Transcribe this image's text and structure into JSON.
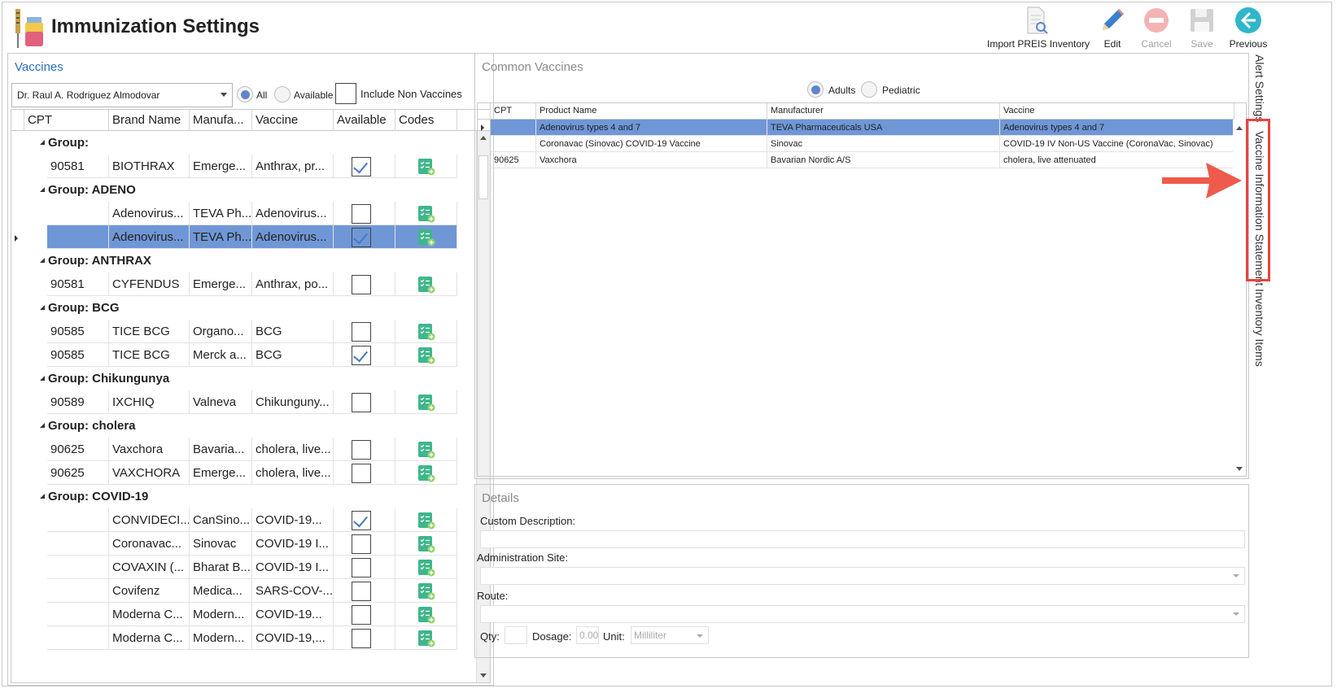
{
  "header": {
    "title": "Immunization Settings",
    "toolbar": {
      "import_label": "Import PREIS Inventory",
      "edit_label": "Edit",
      "cancel_label": "Cancel",
      "save_label": "Save",
      "previous_label": "Previous"
    }
  },
  "vaccines_panel": {
    "title": "Vaccines",
    "provider": "Dr. Raul A. Rodriguez Almodovar",
    "filter_all": "All",
    "filter_available": "Available",
    "filter_selected": "All",
    "include_non_vaccines_label": "Include Non Vaccines",
    "include_non_vaccines_checked": false,
    "columns": [
      "CPT",
      "Brand Name",
      "Manufa...",
      "Vaccine",
      "Available",
      "Codes"
    ],
    "rows": [
      {
        "type": "group",
        "label": "Group:"
      },
      {
        "type": "item",
        "cpt": "90581",
        "brand": "BIOTHRAX",
        "manufacturer": "Emerge...",
        "vaccine": "Anthrax, pr...",
        "available": true
      },
      {
        "type": "group",
        "label": "Group: ADENO"
      },
      {
        "type": "item",
        "cpt": "",
        "brand": "Adenovirus...",
        "manufacturer": "TEVA Ph...",
        "vaccine": "Adenovirus...",
        "available": false
      },
      {
        "type": "item",
        "cpt": "",
        "brand": "Adenovirus...",
        "manufacturer": "TEVA Ph...",
        "vaccine": "Adenovirus...",
        "available": true,
        "selected": true
      },
      {
        "type": "group",
        "label": "Group: ANTHRAX"
      },
      {
        "type": "item",
        "cpt": "90581",
        "brand": "CYFENDUS",
        "manufacturer": "Emerge...",
        "vaccine": "Anthrax, po...",
        "available": false
      },
      {
        "type": "group",
        "label": "Group: BCG"
      },
      {
        "type": "item",
        "cpt": "90585",
        "brand": "TICE BCG",
        "manufacturer": "Organo...",
        "vaccine": "BCG",
        "available": false
      },
      {
        "type": "item",
        "cpt": "90585",
        "brand": "TICE BCG",
        "manufacturer": "Merck a...",
        "vaccine": "BCG",
        "available": true
      },
      {
        "type": "group",
        "label": "Group: Chikungunya"
      },
      {
        "type": "item",
        "cpt": "90589",
        "brand": "IXCHIQ",
        "manufacturer": "Valneva",
        "vaccine": "Chikunguny...",
        "available": false
      },
      {
        "type": "group",
        "label": "Group: cholera"
      },
      {
        "type": "item",
        "cpt": "90625",
        "brand": "Vaxchora",
        "manufacturer": "Bavaria...",
        "vaccine": "cholera, live...",
        "available": false
      },
      {
        "type": "item",
        "cpt": "90625",
        "brand": "VAXCHORA",
        "manufacturer": "Emerge...",
        "vaccine": "cholera, live...",
        "available": false
      },
      {
        "type": "group",
        "label": "Group: COVID-19"
      },
      {
        "type": "item",
        "cpt": "",
        "brand": "CONVIDECI...",
        "manufacturer": "CanSino...",
        "vaccine": "COVID-19...",
        "available": true
      },
      {
        "type": "item",
        "cpt": "",
        "brand": "Coronavac...",
        "manufacturer": "Sinovac",
        "vaccine": "COVID-19 I...",
        "available": false
      },
      {
        "type": "item",
        "cpt": "",
        "brand": "COVAXIN (...",
        "manufacturer": "Bharat B...",
        "vaccine": "COVID-19 I...",
        "available": false
      },
      {
        "type": "item",
        "cpt": "",
        "brand": "Covifenz",
        "manufacturer": "Medica...",
        "vaccine": "SARS-COV-...",
        "available": false
      },
      {
        "type": "item",
        "cpt": "",
        "brand": "Moderna C...",
        "manufacturer": "Modern...",
        "vaccine": "COVID-19...",
        "available": false
      },
      {
        "type": "item",
        "cpt": "",
        "brand": "Moderna C...",
        "manufacturer": "Modern...",
        "vaccine": "COVID-19,...",
        "available": false
      }
    ]
  },
  "common_vaccines": {
    "title": "Common Vaccines",
    "filter_adults": "Adults",
    "filter_pediatric": "Pediatric",
    "filter_selected": "Adults",
    "columns": [
      "CPT",
      "Product Name",
      "Manufacturer",
      "Vaccine"
    ],
    "rows": [
      {
        "cpt": "",
        "product": "Adenovirus types 4 and 7",
        "manufacturer": "TEVA Pharmaceuticals USA",
        "vaccine": "Adenovirus types 4 and 7",
        "selected": true
      },
      {
        "cpt": "",
        "product": "Coronavac (Sinovac) COVID-19 Vaccine",
        "manufacturer": "Sinovac",
        "vaccine": "COVID-19 IV Non-US Vaccine (CoronaVac, Sinovac)"
      },
      {
        "cpt": "90625",
        "product": "Vaxchora",
        "manufacturer": "Bavarian Nordic A/S",
        "vaccine": "cholera, live attenuated"
      }
    ]
  },
  "details": {
    "title": "Details",
    "custom_description_label": "Custom Description:",
    "administration_site_label": "Administration Site:",
    "route_label": "Route:",
    "qty_label": "Qty:",
    "dosage_label": "Dosage:",
    "dosage_value": "0.00",
    "unit_label": "Unit:",
    "unit_value": "Milliliter"
  },
  "side_tabs": {
    "alert_settings": "Alert Settings",
    "vis": "Vaccine Information Statement",
    "inventory_items": "Inventory Items"
  },
  "colors": {
    "selection": "#6f97d6",
    "accent_blue": "#2a6ebb",
    "highlight_red": "#e5453f",
    "codes_green": "#3fb68b"
  }
}
